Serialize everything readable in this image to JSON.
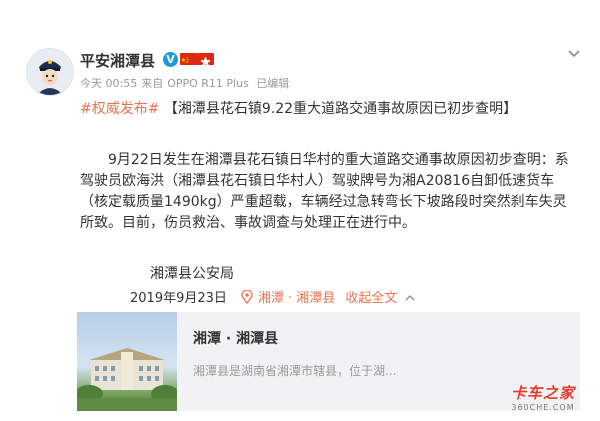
{
  "post": {
    "author": "平安湘潭县",
    "verified_badge": "V",
    "time": "今天 00:55",
    "source_prefix": "来自",
    "device": "OPPO R11 Plus",
    "edited": "已编辑",
    "hashtag": "#权威发布#",
    "headline": "【湘潭县花石镇9.22重大道路交通事故原因已初步查明】",
    "body": "9月22日发生在湘潭县花石镇日华村的重大道路交通事故原因初步查明：系驾驶员欧海洪（湘潭县花石镇日华村人）驾驶牌号为湘A20816自卸低速货车（核定载质量1490kg）严重超载，车辆经过急转弯长下坡路段时突然刹车失灵所致。目前，伤员救治、事故调查与处理正在进行中。",
    "signature": "湘潭县公安局",
    "date": "2019年9月23日",
    "location": "湘潭 · 湘潭县",
    "collapse_label": "收起全文"
  },
  "location_card": {
    "title": "湘潭 · 湘潭县",
    "description": "湘潭县是湖南省湘潭市辖县，位于湖..."
  },
  "watermark": {
    "main": "卡车之家",
    "sub": "360CHE.COM"
  },
  "colors": {
    "accent": "#eb7350",
    "verified": "#1a9bd7",
    "meta": "#999999",
    "card_bg": "#f2f2f5"
  },
  "icons": [
    "police-avatar",
    "verified-v-icon",
    "china-flag-icon",
    "hongkong-flag-icon",
    "chevron-down-icon",
    "location-pin-icon",
    "chevron-up-icon"
  ]
}
